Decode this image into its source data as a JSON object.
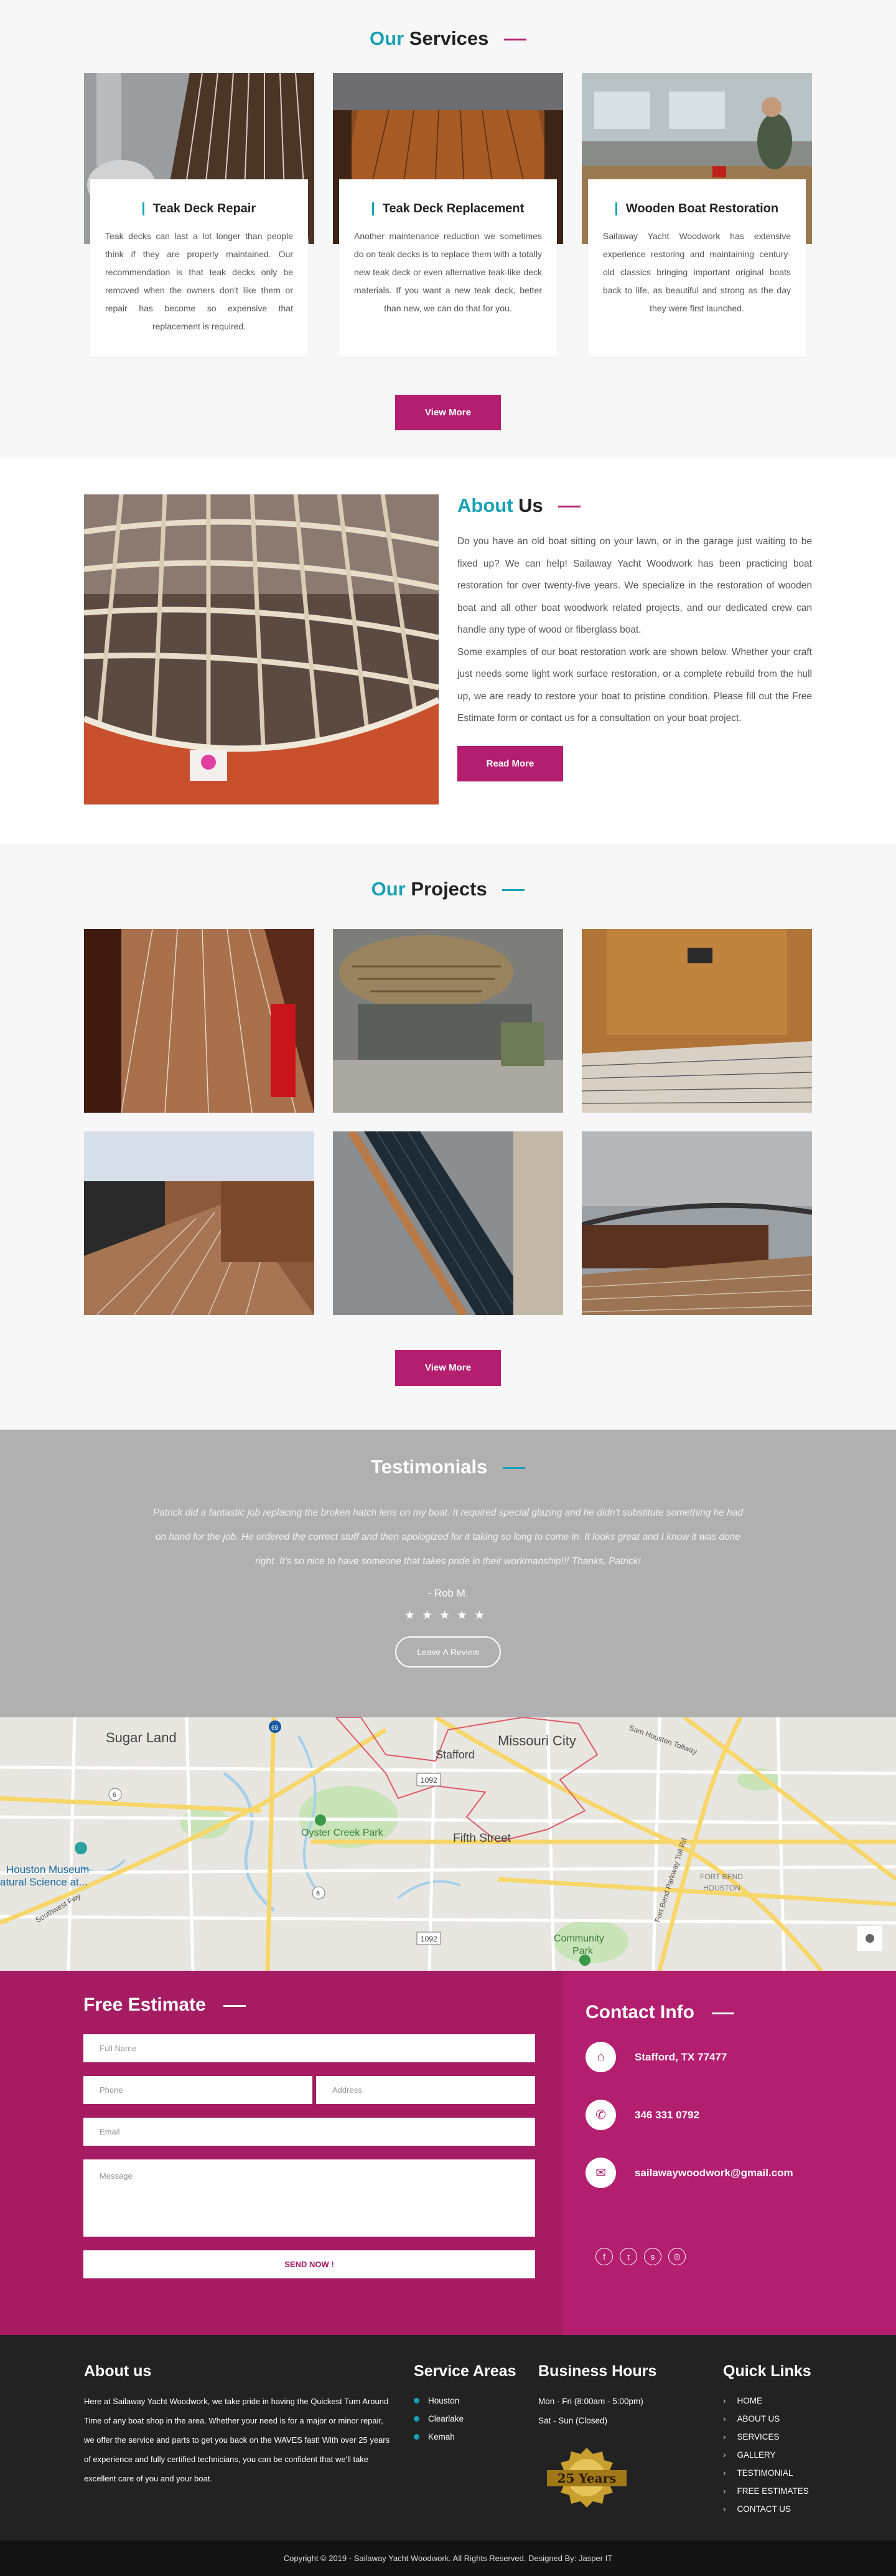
{
  "services": {
    "title_accent": "Our",
    "title_rest": "Services",
    "cards": [
      {
        "title": "Teak Deck Repair",
        "text": "Teak decks can last a lot longer than people think if they are properly maintained. Our recommendation is that teak decks only be removed when the owners don't like them or repair has become so expensive that replacement is required."
      },
      {
        "title": "Teak Deck Replacement",
        "text": "Another maintenance reduction we sometimes do on teak decks is to replace them with a totally new teak deck or even alternative teak-like deck materials. If you want a new teak deck, better than new, we can do that for you."
      },
      {
        "title": "Wooden Boat Restoration",
        "text": "Sailaway Yacht Woodwork has extensive experience restoring and maintaining century-old classics bringing important original boats back to life, as beautiful and strong as the day they were first launched."
      }
    ],
    "button": "View More"
  },
  "about": {
    "title_accent": "About",
    "title_rest": "Us",
    "para1": "Do you have an old boat sitting on your lawn, or in the garage just waiting to be fixed up? We can help! Sailaway Yacht Woodwork has been practicing boat restoration for over twenty-five years. We specialize in the restoration of wooden boat and all other boat woodwork related projects, and our dedicated crew can handle any type of wood or fiberglass boat.",
    "para2": "Some examples of our boat restoration work are shown below. Whether your craft just needs some light work surface restoration, or a complete rebuild from the hull up, we are ready to restore your boat to pristine condition. Please fill out the Free Estimate form or contact us for a consultation on your boat project.",
    "button": "Read More"
  },
  "projects": {
    "title_accent": "Our",
    "title_rest": "Projects",
    "button": "View More"
  },
  "testimonials": {
    "title": "Testimonials",
    "quote": "Patrick did a fantastic job replacing the broken hatch lens on my boat. It required special glazing and he didn't substitute something he had on hand for the job.  He ordered the correct stuff and then apologized for it taking so long to come in. It looks great and I know it was done right. It's so nice to have someone that takes pride in their workmanship!!! Thanks, Patrick!",
    "author": "- Rob M.",
    "stars": "★★★★★",
    "rating": 5,
    "button": "Leave A Review"
  },
  "map": {
    "labels": [
      "Sugar Land",
      "Missouri City",
      "Stafford",
      "Oyster Creek Park",
      "Fifth Street",
      "Houston Museum",
      "atural Science at...",
      "Community",
      "Park",
      "FORT BEND",
      "HOUSTON",
      "Sam Houston Tollway",
      "Fort Bend Parkway Toll Rd",
      "Southwest Fwy",
      "1092",
      "1092",
      "69",
      "6",
      "6"
    ]
  },
  "estimate": {
    "title": "Free Estimate",
    "fields": {
      "name": "Full Name",
      "phone": "Phone",
      "address": "Address",
      "email": "Email",
      "message": "Message"
    },
    "button": "SEND NOW !"
  },
  "contact": {
    "title": "Contact Info",
    "address": "Stafford, TX 77477",
    "phone": "346 331 0792",
    "email": "sailawaywoodwork@gmail.com"
  },
  "footer": {
    "about_title": "About us",
    "about_text": "Here at Sailaway Yacht Woodwork, we take pride in having the Quickest Turn Around Time of any boat shop in the area. Whether your need is for a major or minor repair, we offer the service and parts to get you back on the WAVES fast! With over 25 years of experience and fully certified technicians, you can be confident that we'll take excellent care of you and your boat.",
    "areas_title": "Service Areas",
    "areas": [
      "Houston",
      "Clearlake",
      "Kemah"
    ],
    "hours_title": "Business Hours",
    "hours": [
      "Mon - Fri (8:00am - 5:00pm)",
      "Sat - Sun (Closed)"
    ],
    "badge": "25 Years",
    "links_title": "Quick Links",
    "links": [
      "HOME",
      "ABOUT US",
      "SERVICES",
      "GALLERY",
      "TESTIMONIAL",
      "FREE ESTIMATES",
      "CONTACT US"
    ],
    "copyright": "Copyright © 2019 - Sailaway Yacht Woodwork. All Rights Reserved. Designed By: Jasper IT"
  }
}
